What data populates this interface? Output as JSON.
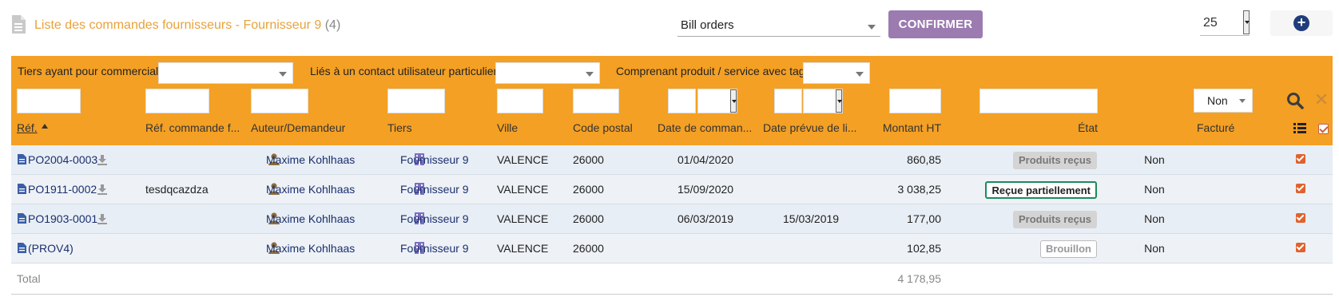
{
  "header": {
    "title": "Liste des commandes fournisseurs - Fournisseur 9",
    "count": "(4)",
    "mass_action": "Bill orders",
    "confirm_label": "CONFIRMER",
    "limit": "25"
  },
  "filters": {
    "commercial_label": "Tiers ayant pour commercial:",
    "contact_label": "Liés à un contact utilisateur particulier:",
    "tag_label": "Comprenant produit / service avec tag:",
    "billed_value": "Non"
  },
  "columns": {
    "ref": "Réf.",
    "supplier_ref": "Réf. commande f...",
    "author": "Auteur/Demandeur",
    "thirdparty": "Tiers",
    "town": "Ville",
    "zip": "Code postal",
    "order_date": "Date de comman...",
    "delivery_date": "Date prévue de li...",
    "amount": "Montant HT",
    "status": "État",
    "billed": "Facturé"
  },
  "rows": [
    {
      "ref": "PO2004-0003",
      "supplier_ref": "",
      "author": "Maxime Kohlhaas",
      "thirdparty": "Fournisseur 9",
      "town": "VALENCE",
      "zip": "26000",
      "order_date": "01/04/2020",
      "delivery_date": "",
      "amount": "860,85",
      "status": "Produits reçus",
      "billed": "Non"
    },
    {
      "ref": "PO1911-0002",
      "supplier_ref": "tesdqcazdza",
      "author": "Maxime Kohlhaas",
      "thirdparty": "Fournisseur 9",
      "town": "VALENCE",
      "zip": "26000",
      "order_date": "15/09/2020",
      "delivery_date": "",
      "amount": "3 038,25",
      "status": "Reçue partiellement",
      "billed": "Non"
    },
    {
      "ref": "PO1903-0001",
      "supplier_ref": "",
      "author": "Maxime Kohlhaas",
      "thirdparty": "Fournisseur 9",
      "town": "VALENCE",
      "zip": "26000",
      "order_date": "06/03/2019",
      "delivery_date": "15/03/2019",
      "amount": "177,00",
      "status": "Produits reçus",
      "billed": "Non"
    },
    {
      "ref": "(PROV4)",
      "supplier_ref": "",
      "author": "Maxime Kohlhaas",
      "thirdparty": "Fournisseur 9",
      "town": "VALENCE",
      "zip": "26000",
      "order_date": "",
      "delivery_date": "",
      "amount": "102,85",
      "status": "Brouillon",
      "billed": "Non"
    }
  ],
  "total": {
    "label": "Total",
    "amount": "4 178,95"
  },
  "colors": {
    "accent": "#f4a024",
    "title": "#e8a23a",
    "confirm": "#9b7bb0",
    "link": "#1a2f6e"
  }
}
